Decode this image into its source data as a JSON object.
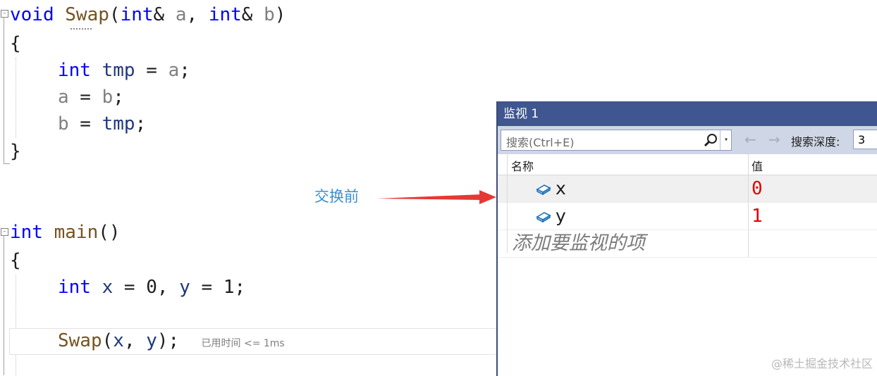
{
  "editor": {
    "swap": {
      "kw_void": "void",
      "fn_name": "Swap",
      "open": "(",
      "kw_int1": "int",
      "amp1": "& ",
      "param_a": "a",
      "comma": ", ",
      "kw_int2": "int",
      "amp2": "& ",
      "param_b": "b",
      "close": ")",
      "brace_open": "{",
      "l1_kw": "int",
      "l1_var": "tmp",
      "l1_eq": " = ",
      "l1_rhs": "a",
      "l1_semi": ";",
      "l2_lhs": "a",
      "l2_eq": " = ",
      "l2_rhs": "b",
      "l2_semi": ";",
      "l3_lhs": "b",
      "l3_eq": " = ",
      "l3_rhs": "tmp",
      "l3_semi": ";",
      "brace_close": "}"
    },
    "main": {
      "kw_int": "int",
      "fn_name": "main",
      "parens": "()",
      "brace_open": "{",
      "decl_kw": "int",
      "decl_x": "x",
      "decl_eq1": " = 0, ",
      "decl_y": "y",
      "decl_eq2": " = 1;",
      "call_fn": "Swap",
      "call_open": "(",
      "call_x": "x",
      "call_comma": ", ",
      "call_y": "y",
      "call_close": ");",
      "elapsed": "已用时间 <= 1ms"
    },
    "fold_minus": "-"
  },
  "annotation": {
    "label": "交换前",
    "arrow_color": "#e53935"
  },
  "watch": {
    "title": "监视 1",
    "search_placeholder": "搜索(Ctrl+E)",
    "search_icon": "search-icon",
    "dropdown_glyph": "▾",
    "back_glyph": "←",
    "forward_glyph": "→",
    "depth_label": "搜索深度:",
    "depth_value": "3",
    "columns": {
      "name": "名称",
      "value": "值"
    },
    "rows": [
      {
        "name": "x",
        "value": "0",
        "icon": "variable-icon"
      },
      {
        "name": "y",
        "value": "1",
        "icon": "variable-icon"
      }
    ],
    "add_item_placeholder": "添加要监视的项"
  },
  "watermark": "@稀土掘金技术社区",
  "colors": {
    "keyword": "#0000ff",
    "function": "#74531f",
    "parameter": "#808080",
    "local": "#1f377f",
    "watch_title_bg": "#3f5690",
    "value_changed": "#e00000"
  }
}
